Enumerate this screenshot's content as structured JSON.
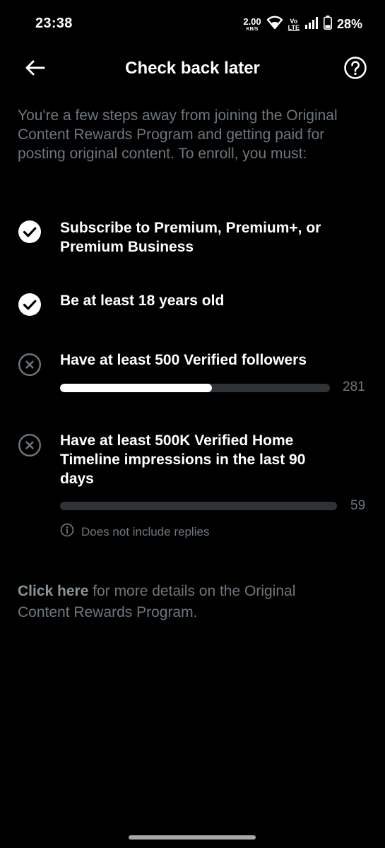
{
  "status_bar": {
    "time": "23:38",
    "net_speed_value": "2.00",
    "net_speed_unit": "KB/S",
    "volte_top": "Vo",
    "volte_bottom": "LTE",
    "battery": "28%",
    "icons": [
      "wifi-icon",
      "signal-icon",
      "battery-icon"
    ]
  },
  "header": {
    "title": "Check back later",
    "back_icon": "arrow-left-icon",
    "help_icon": "question-circle-icon"
  },
  "intro": "You're a few steps away from joining the Original Content Rewards Program and getting paid for posting original content. To enroll, you must:",
  "requirements": [
    {
      "text_line1": "Subscribe to Premium, Premium+, or",
      "text_line2": "Premium Business",
      "status": "met",
      "icon": "check-circle-icon"
    },
    {
      "text_line1": "Be at least 18 years old",
      "status": "met",
      "icon": "check-circle-icon"
    },
    {
      "text_line1": "Have at least 500 Verified followers",
      "status": "not-met",
      "icon": "x-circle-icon",
      "progress_value": "281",
      "progress_current": 281,
      "progress_target": 500
    },
    {
      "text_line1": "Have at least 500K Verified Home",
      "text_line2": "Timeline impressions in the last 90",
      "text_line3": "days",
      "status": "not-met",
      "icon": "x-circle-icon",
      "progress_value": "59",
      "progress_current": 59,
      "progress_target": 500000,
      "note": "Does not include replies",
      "note_icon": "info-icon"
    }
  ],
  "footer": {
    "link_text": "Click here",
    "rest_line1": " for more details on the Original",
    "rest_line2": "Content Rewards Program."
  },
  "colors": {
    "background": "#000000",
    "text": "#ffffff",
    "muted": "#6e767d",
    "track": "#2f3336",
    "fill": "#ffffff"
  }
}
